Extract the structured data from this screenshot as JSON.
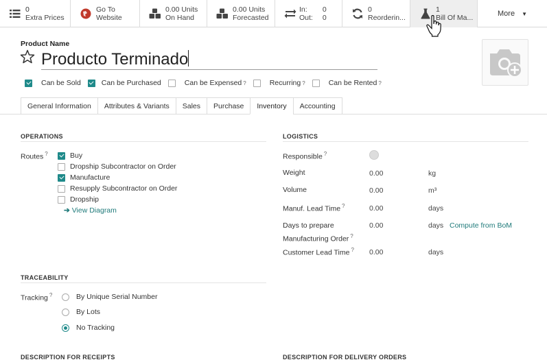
{
  "smart_buttons": [
    {
      "icon": "list-icon",
      "num": "0",
      "label": "Extra Prices"
    },
    {
      "icon": "globe-icon",
      "num": "Go To",
      "label": "Website"
    },
    {
      "icon": "cubes-icon",
      "num": "0.00 Units",
      "label": "On Hand"
    },
    {
      "icon": "cubes-icon",
      "num": "0.00 Units",
      "label": "Forecasted"
    },
    {
      "icon": "exchange-icon",
      "in_label": "In:",
      "in_val": "0",
      "out_label": "Out:",
      "out_val": "0"
    },
    {
      "icon": "refresh-icon",
      "num": "0",
      "label": "Reorderin..."
    },
    {
      "icon": "flask-icon",
      "num": "1",
      "label": "Bill Of Ma..."
    }
  ],
  "more_label": "More",
  "product": {
    "name_label": "Product Name",
    "name": "Producto Terminado"
  },
  "flags": [
    {
      "label": "Can be Sold",
      "checked": true,
      "help": ""
    },
    {
      "label": "Can be Purchased",
      "checked": true,
      "help": ""
    },
    {
      "label": "Can be Expensed",
      "checked": false,
      "help": "?"
    },
    {
      "label": "Recurring",
      "checked": false,
      "help": "?"
    },
    {
      "label": "Can be Rented",
      "checked": false,
      "help": "?"
    }
  ],
  "tabs": [
    "General Information",
    "Attributes & Variants",
    "Sales",
    "Purchase",
    "Inventory",
    "Accounting"
  ],
  "active_tab": "Inventory",
  "operations": {
    "title": "OPERATIONS",
    "routes_label": "Routes",
    "routes_help": "?",
    "routes": [
      {
        "label": "Buy",
        "checked": true
      },
      {
        "label": "Dropship Subcontractor on Order",
        "checked": false
      },
      {
        "label": "Manufacture",
        "checked": true
      },
      {
        "label": "Resupply Subcontractor on Order",
        "checked": false
      },
      {
        "label": "Dropship",
        "checked": false
      }
    ],
    "view_diagram": "View Diagram"
  },
  "logistics": {
    "title": "LOGISTICS",
    "responsible_label": "Responsible",
    "weight_label": "Weight",
    "weight": "0.00",
    "weight_unit": "kg",
    "volume_label": "Volume",
    "volume": "0.00",
    "volume_unit": "m³",
    "lead_label": "Manuf. Lead Time",
    "lead": "0.00",
    "lead_unit": "days",
    "prepare_label_1": "Days to prepare",
    "prepare_label_2": "Manufacturing Order",
    "prepare": "0.00",
    "prepare_unit": "days",
    "compute_link": "Compute from BoM",
    "customer_label": "Customer Lead Time",
    "customer": "0.00",
    "customer_unit": "days"
  },
  "traceability": {
    "title": "TRACEABILITY",
    "tracking_label": "Tracking",
    "options": [
      {
        "label": "By Unique Serial Number",
        "selected": false
      },
      {
        "label": "By Lots",
        "selected": false
      },
      {
        "label": "No Tracking",
        "selected": true
      }
    ]
  },
  "desc_receipts": "DESCRIPTION FOR RECEIPTS",
  "desc_delivery": "DESCRIPTION FOR DELIVERY ORDERS",
  "colors": {
    "accent": "#1f8a8a",
    "link": "#1f7a7a"
  }
}
